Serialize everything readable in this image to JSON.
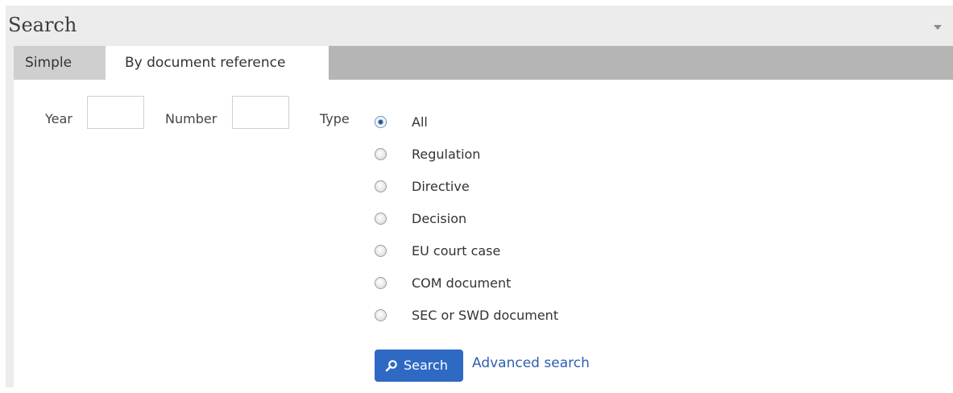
{
  "panel": {
    "title": "Search",
    "collapse_icon": "chevron-down-icon"
  },
  "tabs": [
    {
      "label": "Simple",
      "active": false
    },
    {
      "label": "By document reference",
      "active": true
    }
  ],
  "form": {
    "year_label": "Year",
    "year_value": "",
    "number_label": "Number",
    "number_value": "",
    "type_label": "Type",
    "type_options": [
      {
        "label": "All",
        "checked": true
      },
      {
        "label": "Regulation",
        "checked": false
      },
      {
        "label": "Directive",
        "checked": false
      },
      {
        "label": "Decision",
        "checked": false
      },
      {
        "label": "EU court case",
        "checked": false
      },
      {
        "label": "COM document",
        "checked": false
      },
      {
        "label": "SEC or SWD document",
        "checked": false
      }
    ]
  },
  "actions": {
    "search_label": "Search",
    "search_icon": "search-icon",
    "advanced_label": "Advanced search"
  },
  "colors": {
    "accent": "#2e69c4",
    "link": "#2e5fb0",
    "tab_bar": "#b5b5b5",
    "panel_bg": "#ececec"
  }
}
